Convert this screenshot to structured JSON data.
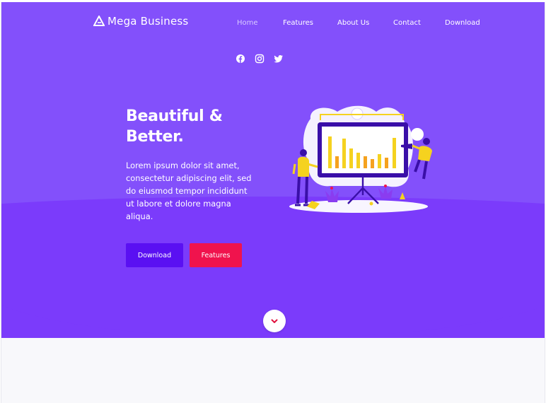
{
  "brand": {
    "name": "Mega Business",
    "icon": "triangle-logo-icon"
  },
  "nav": {
    "items": [
      {
        "label": "Home",
        "active": true
      },
      {
        "label": "Features",
        "active": false
      },
      {
        "label": "About Us",
        "active": false
      },
      {
        "label": "Contact",
        "active": false
      },
      {
        "label": "Download",
        "active": false
      }
    ]
  },
  "social": {
    "icons": [
      "facebook-icon",
      "instagram-icon",
      "twitter-icon"
    ]
  },
  "hero": {
    "headline_line1": "Beautiful &",
    "headline_line2": "Better.",
    "description": "Lorem ipsum dolor sit amet, consectetur adipiscing elit, sed do eiusmod tempor incididunt ut labore et dolore magna aliqua.",
    "download_label": "Download",
    "features_label": "Features"
  },
  "scroll": {
    "icon": "chevron-down-icon"
  },
  "colors": {
    "hero_bg": "#8350fb",
    "hero_lower": "#7b3bfb",
    "download_button": "#5a10f2",
    "features_button": "#f0134d",
    "page_bg": "#f8f8fb"
  }
}
